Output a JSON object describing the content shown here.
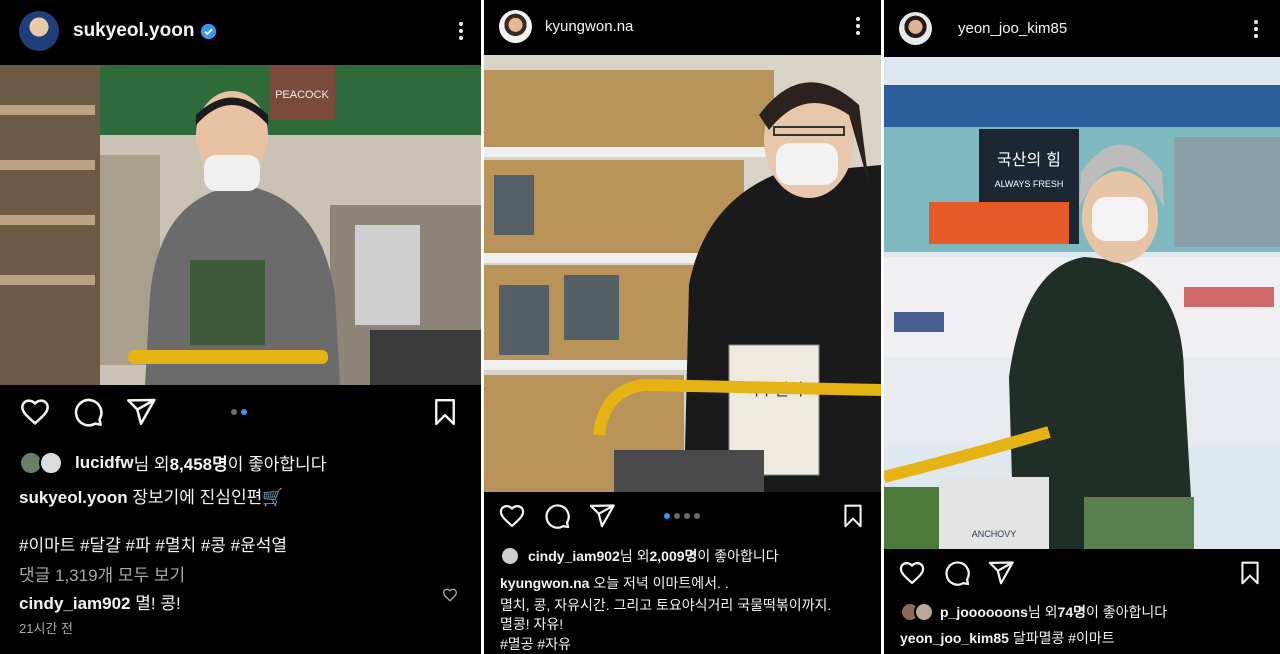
{
  "posts": [
    {
      "username": "sukyeol.yoon",
      "verified": true,
      "likes_user": "lucidfw",
      "likes_middle": "님 외 ",
      "likes_count": "8,458명",
      "likes_suffix": "이 좋아합니다",
      "caption_user": "sukyeol.yoon",
      "caption": "장보기에 진심인편🛒",
      "hashtags": "#이마트 #달걀 #파 #멸치 #콩 #윤석열",
      "view_comments": "댓글 1,319개 모두 보기",
      "comment_user": "cindy_iam902",
      "comment_text": "멸! 콩!",
      "time": "21시간 전",
      "carousel": {
        "count": 2,
        "active": 2
      },
      "scene": {
        "colors": {
          "shelf": "#6d5a45",
          "wall": "#2f6b3a",
          "jacket": "#6b6b6b",
          "cart": "#e5b414"
        },
        "sign": "PEACOCK"
      }
    },
    {
      "username": "kyungwon.na",
      "likes_user": "cindy_iam902",
      "likes_middle": "님 외 ",
      "likes_count": "2,009명",
      "likes_suffix": "이 좋아합니다",
      "caption_user": "kyungwon.na",
      "caption": "오늘 저녁 이마트에서. .",
      "caption_line2": "멸치, 콩, 자유시간. 그리고 토요야식거리 국물떡볶이까지.",
      "caption_line3": "멸콩! 자유!",
      "hashtags": "#멸공 #자유",
      "carousel": {
        "count": 4,
        "active": 1
      },
      "scene": {
        "colors": {
          "shelf": "#d8d4c8",
          "goods": "#b8945a",
          "jacket": "#1a1a1a",
          "cart": "#e5b414"
        },
        "package": "여수멸치"
      }
    },
    {
      "username": "yeon_joo_kim85",
      "likes_user": "p_joooooons",
      "likes_middle": "님 외 ",
      "likes_count": "74명",
      "likes_suffix": "이 좋아합니다",
      "caption_user": "yeon_joo_kim85",
      "caption": "달파멸콩 #이마트",
      "scene": {
        "colors": {
          "fridge": "#dfe8ee",
          "banner": "#2a5e9c",
          "jacket": "#1f2e26",
          "cart": "#e5b414"
        },
        "sign": "국산의 힘",
        "sign_sub": "ALWAYS FRESH",
        "package": "ANCHOVY"
      }
    }
  ]
}
